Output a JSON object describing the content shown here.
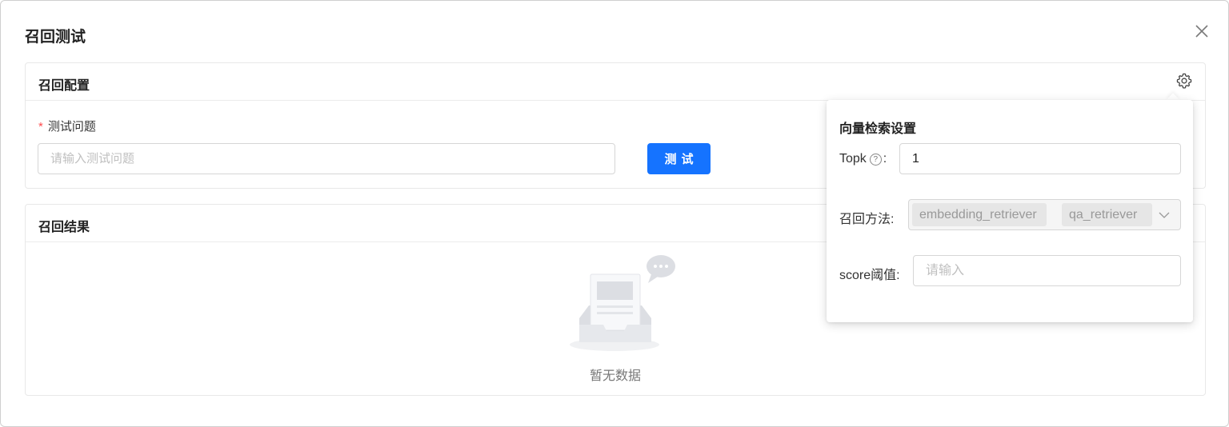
{
  "dialog": {
    "title": "召回测试"
  },
  "config": {
    "title": "召回配置",
    "question_label": "测试问题",
    "required_mark": "*",
    "question_placeholder": "请输入测试问题",
    "question_value": "",
    "test_button": "测试"
  },
  "results": {
    "title": "召回结果",
    "empty_text": "暂无数据"
  },
  "popover": {
    "title": "向量检索设置",
    "topk_label": "Topk",
    "topk_help": "?",
    "topk_colon": ":",
    "topk_value": "1",
    "method_label": "召回方法:",
    "methods": [
      "embedding_retriever",
      "qa_retriever"
    ],
    "score_label": "score阈值:",
    "score_placeholder": "请输入"
  },
  "icons": {
    "close": "close-icon",
    "settings": "gear-icon",
    "help": "question-circle-icon",
    "dropdown": "chevron-down-icon",
    "empty": "empty-inbox-icon"
  },
  "colors": {
    "primary": "#1573ff",
    "required": "#ff4d4f"
  }
}
